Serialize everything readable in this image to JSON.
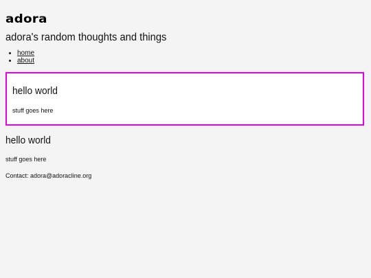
{
  "site": {
    "logo": "adora",
    "title": "adora's random thoughts and things"
  },
  "nav": {
    "items": [
      {
        "label": "home"
      },
      {
        "label": "about"
      }
    ]
  },
  "posts": [
    {
      "title": "hello world",
      "body": "stuff goes here"
    },
    {
      "title": "hello world",
      "body": "stuff goes here"
    }
  ],
  "footer": {
    "contact": "Contact: adora@adoracline.org"
  },
  "colors": {
    "highlight_border": "#e600e6",
    "page_background": "#f4f4f4"
  }
}
